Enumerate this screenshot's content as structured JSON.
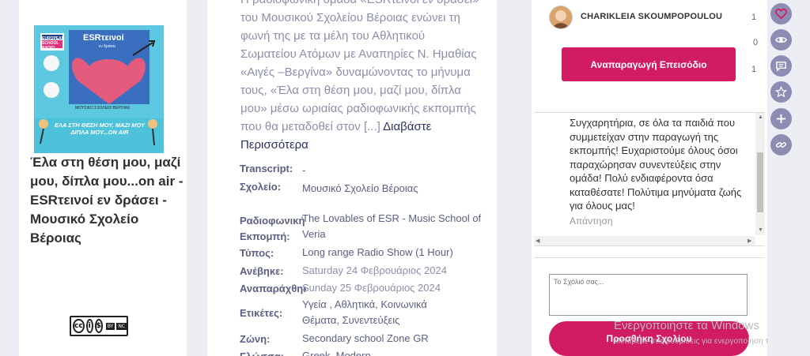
{
  "podcast": {
    "cover_text": {
      "badge": "EUROPEAN SCHOOL RADIO",
      "logo": "ESRτεινοί",
      "logo_sub": "εν δράσει",
      "school_label": "ΜΟΥΣΙΚΟ ΣΧΟΛΕΙΟ ΒΕΡΟΙΑΣ",
      "caption": "ΕΛΑ ΣΤΗ ΘΕΣΗ ΜΟΥ, ΜΑΖΙ ΜΟΥ ΔΙΠΛΑ ΜΟΥ...ON AIR"
    },
    "title": "Έλα στη θέση μου, μαζί μου, δίπλα μου...on air - ESRτεινοί εν δράσει - Μουσικό Σχολείο Βέροιας",
    "license": {
      "by": "BY",
      "nc": "NC"
    }
  },
  "description": {
    "text": "Η ραδιοφωνική ομάδα «ESRτεινοί εν δράσει» του Μουσικού Σχολείου Βέροιας ενώνει τη φωνή της με τα μέλη του Αθλητικού Σωματείου Ατόμων με Αναπηρίες Ν. Ημαθίας «Αιγές –Βεργίνα» δυναμώνοντας το μήνυμα τους, «Έλα στη θέση μου, μαζί μου, δίπλα μου» μέσω ωριαίας ραδιοφωνικής εκπομπής που θα μεταδοθεί στον",
    "ellipsis": "[...]",
    "read_more": "Διαβάστε Περισσότερα"
  },
  "meta": [
    {
      "key": "Transcript:",
      "value": "-"
    },
    {
      "key": "Σχολείο:",
      "value": "Μουσικό Σχολείο Βέροιας"
    },
    {
      "key": "Ραδιοφωνική Εκπομπή:",
      "value": "The Lovables of ESR - Music School of Veria"
    },
    {
      "key": "Τύπος:",
      "value": "Long range Radio Show (1 Hour)"
    },
    {
      "key": "Ανέβηκε:",
      "value": "Saturday 24 Φεβρουάριος 2024"
    },
    {
      "key": "Αναπαράχθηκε:",
      "value": "Sunday 25 Φεβρουάριος 2024"
    },
    {
      "key": "Ετικέτες:",
      "value": "Υγεία , Αθλητικά, Κοινωνικά Θέματα, Συνεντεύξεις"
    },
    {
      "key": "Ζώνη:",
      "value": "Secondary school Zone GR"
    },
    {
      "key": "Γλώσσα:",
      "value": "Greek, Modern"
    }
  ],
  "comment_panel": {
    "author": "CHARIKLEIA SKOUMPOPOULOU",
    "counts": [
      "1",
      "0",
      "1"
    ],
    "play_label": "Αναπαραγωγή Επεισόδιο",
    "comment_text": "Συγχαρητήρια, σε όλα τα παιδιά που συμμετείχαν στην παραγωγή της εκπομπής! Ευχαριστούμε όλους όσοι παραχώρησαν συνεντεύξεις στην ομάδα! Πολύ ενδιαφέροντα όσα καταθέσατε! Πολύτιμα μηνύματα ζωής για όλους μας!",
    "reply_label": "Απάντηση",
    "textarea_placeholder": "Το Σχόλιό σας...",
    "submit_label": "Προσθήκη Σχολίου"
  },
  "rail": {
    "icons": [
      "heart-icon",
      "eye-icon",
      "comment-icon",
      "star-icon",
      "plus-icon",
      "link-icon"
    ],
    "colors": {
      "active_bg": "#8b8db3",
      "heart": "#d11b62"
    }
  },
  "watermark": {
    "title": "Ενεργοποιήστε τα Windows",
    "subtitle": "Μεταβείτε στις ρυθμίσεις για ενεργοποίηση τ"
  },
  "colors": {
    "accent": "#d11b62",
    "muted_text": "#8c8fab",
    "link": "#2c3265",
    "page_bg": "#eceef3"
  }
}
